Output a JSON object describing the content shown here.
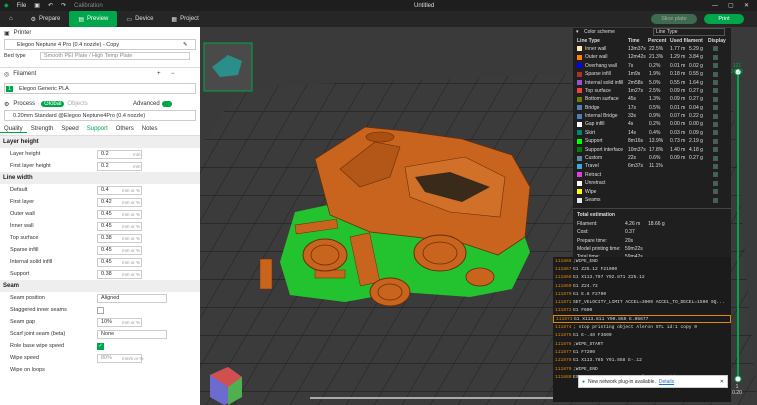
{
  "menu": {
    "file": "File",
    "calibration": "Calibration",
    "title": "Untitled"
  },
  "tabs": {
    "home": "",
    "prepare": "Prepare",
    "preview": "Preview",
    "device": "Device",
    "project": "Project"
  },
  "actions": {
    "slice": "Slice plate",
    "print": "Print"
  },
  "printer": {
    "header": "Printer",
    "name": "Elegoo Neptune 4 Pro (0.4 nozzle) - Copy",
    "bed_label": "Bed type",
    "bed_value": "Smooth PEI Plate / High Temp Plate"
  },
  "filament": {
    "header": "Filament",
    "item_index": "1",
    "item": "Elegoo Generic PLA"
  },
  "process": {
    "header": "Process",
    "global": "Global",
    "objects": "Objects",
    "advanced": "Advanced",
    "profile": "0.20mm Standard @Elegoo Neptune4Pro (0.4 nozzle)"
  },
  "subtabs": [
    "Quality",
    "Strength",
    "Speed",
    "Support",
    "Others",
    "Notes"
  ],
  "quality": {
    "layer_height_group": "Layer height",
    "layer_height": {
      "label": "Layer height",
      "value": "0.2",
      "unit": "mm"
    },
    "first_layer_height": {
      "label": "First layer height",
      "value": "0.2",
      "unit": "mm"
    },
    "line_width_group": "Line width",
    "widths": [
      {
        "label": "Default",
        "value": "0.4",
        "unit": "mm or %"
      },
      {
        "label": "First layer",
        "value": "0.42",
        "unit": "mm or %"
      },
      {
        "label": "Outer wall",
        "value": "0.45",
        "unit": "mm or %"
      },
      {
        "label": "Inner wall",
        "value": "0.45",
        "unit": "mm or %"
      },
      {
        "label": "Top surface",
        "value": "0.38",
        "unit": "mm or %"
      },
      {
        "label": "Sparse infill",
        "value": "0.45",
        "unit": "mm or %"
      },
      {
        "label": "Internal solid infill",
        "value": "0.45",
        "unit": "mm or %"
      },
      {
        "label": "Support",
        "value": "0.38",
        "unit": "mm or %"
      }
    ],
    "seam_group": "Seam",
    "seam_position": {
      "label": "Seam position",
      "value": "Aligned"
    },
    "staggered": {
      "label": "Staggered inner seams"
    },
    "seam_gap": {
      "label": "Seam gap",
      "value": "10%",
      "unit": "mm or %"
    },
    "scarf": {
      "label": "Scarf joint seam (beta)",
      "value": "None"
    },
    "role_wipe": {
      "label": "Role base wipe speed"
    },
    "wipe_speed": {
      "label": "Wipe speed",
      "value": "80%",
      "unit": "mm/s or %"
    },
    "wipe_loops": {
      "label": "Wipe on loops"
    }
  },
  "legend": {
    "color_scheme": "Color scheme",
    "scheme_value": "Line Type",
    "headers": {
      "type": "Line Type",
      "time": "Time",
      "percent": "Percent",
      "used": "Used filament",
      "display": "Display"
    },
    "rows": [
      {
        "name": "Inner wall",
        "color": "#ffe6b3",
        "time": "13m37s",
        "percent": "22.5%",
        "len": "1.77 m",
        "g": "5.29 g"
      },
      {
        "name": "Outer wall",
        "color": "#ff8000",
        "time": "12m42s",
        "percent": "21.3%",
        "len": "1.29 m",
        "g": "3.84 g"
      },
      {
        "name": "Overhang wall",
        "color": "#0000ff",
        "time": "7s",
        "percent": "0.2%",
        "len": "0.01 m",
        "g": "0.02 g"
      },
      {
        "name": "Sparse infill",
        "color": "#b03029",
        "time": "1m9s",
        "percent": "1.9%",
        "len": "0.18 m",
        "g": "0.55 g"
      },
      {
        "name": "Internal solid infill",
        "color": "#9654cc",
        "time": "2m58s",
        "percent": "5.0%",
        "len": "0.55 m",
        "g": "1.64 g"
      },
      {
        "name": "Top surface",
        "color": "#f04040",
        "time": "1m27s",
        "percent": "2.5%",
        "len": "0.09 m",
        "g": "0.27 g"
      },
      {
        "name": "Bottom surface",
        "color": "#668000",
        "time": "45s",
        "percent": "1.3%",
        "len": "0.09 m",
        "g": "0.27 g"
      },
      {
        "name": "Bridge",
        "color": "#4d80b3",
        "time": "17s",
        "percent": "0.5%",
        "len": "0.01 m",
        "g": "0.04 g"
      },
      {
        "name": "Internal Bridge",
        "color": "#4d80b3",
        "time": "33s",
        "percent": "0.9%",
        "len": "0.07 m",
        "g": "0.22 g"
      },
      {
        "name": "Gap infill",
        "color": "#ffffff",
        "time": "4s",
        "percent": "0.2%",
        "len": "0.00 m",
        "g": "0.00 g"
      },
      {
        "name": "Skirt",
        "color": "#00876e",
        "time": "14s",
        "percent": "0.4%",
        "len": "0.03 m",
        "g": "0.09 g"
      },
      {
        "name": "Support",
        "color": "#00ff00",
        "time": "8m16s",
        "percent": "13.9%",
        "len": "0.73 m",
        "g": "2.19 g"
      },
      {
        "name": "Support interface",
        "color": "#008000",
        "time": "10m37s",
        "percent": "17.8%",
        "len": "1.40 m",
        "g": "4.18 g"
      },
      {
        "name": "Custom",
        "color": "#5e8a9e",
        "time": "22s",
        "percent": "0.6%",
        "len": "0.09 m",
        "g": "0.27 g"
      },
      {
        "name": "Travel",
        "color": "#38ace0",
        "time": "6m37s",
        "percent": "11.1%",
        "len": "",
        "g": ""
      },
      {
        "name": "Retract",
        "color": "#e040e0",
        "time": "",
        "percent": "",
        "len": "",
        "g": ""
      },
      {
        "name": "Unretract",
        "color": "#ffffff",
        "time": "",
        "percent": "",
        "len": "",
        "g": ""
      },
      {
        "name": "Wipe",
        "color": "#ffff00",
        "time": "",
        "percent": "",
        "len": "",
        "g": ""
      },
      {
        "name": "Seams",
        "color": "#e6e6e6",
        "time": "",
        "percent": "",
        "len": "",
        "g": ""
      }
    ],
    "total_header": "Total estimation",
    "totals": [
      {
        "label": "Filament:",
        "a": "4.26 m",
        "b": "18.66 g"
      },
      {
        "label": "Cost:",
        "a": "0.37",
        "b": ""
      },
      {
        "label": "Prepare time:",
        "a": "20s",
        "b": ""
      },
      {
        "label": "Model printing time:",
        "a": "59m22s",
        "b": ""
      },
      {
        "label": "Total time:",
        "a": "59m42s",
        "b": ""
      }
    ]
  },
  "gcode": [
    {
      "n": "111866",
      "t": ";WIPE_END"
    },
    {
      "n": "111867",
      "t": "G1 Z25.12 F21000"
    },
    {
      "n": "111868",
      "t": "G1 X113.797 Y92.871 Z25.12"
    },
    {
      "n": "111869",
      "t": "G1 Z24.72"
    },
    {
      "n": "111870",
      "t": "G1 E.8 F2700"
    },
    {
      "n": "111871",
      "t": "SET_VELOCITY_LIMIT ACCEL=3000 ACCEL_TO_DECEL=1500 SQ..."
    },
    {
      "n": "111872",
      "t": "G1 F600"
    },
    {
      "n": "111873",
      "t": "G1 X113.811 Y90.859 E.05677"
    },
    {
      "n": "111874",
      "t": "; stop printing object Aleron STL id:1 copy 0"
    },
    {
      "n": "111875",
      "t": "G1 E-.48 F3600"
    },
    {
      "n": "111876",
      "t": ";WIPE_START"
    },
    {
      "n": "111877",
      "t": "G1 F7200"
    },
    {
      "n": "111878",
      "t": "G1 X113.785 Y91.858 E-.12"
    },
    {
      "n": "111879",
      "t": ";WIPE_END"
    },
    {
      "n": "111880",
      "t": "EXCLUDE_OBJECT_END NAME=Aleron_STL_id_1_copy_0"
    }
  ],
  "notice": {
    "text": "New network plug-in available.",
    "link": "Details"
  },
  "slider": {
    "top_layer": "121",
    "top_height": "24.72",
    "bottom_layer": "1",
    "bottom_height": "0.20"
  },
  "colors": {
    "accent": "#00a64b",
    "model": "#c8641e",
    "support": "#22c32e"
  }
}
